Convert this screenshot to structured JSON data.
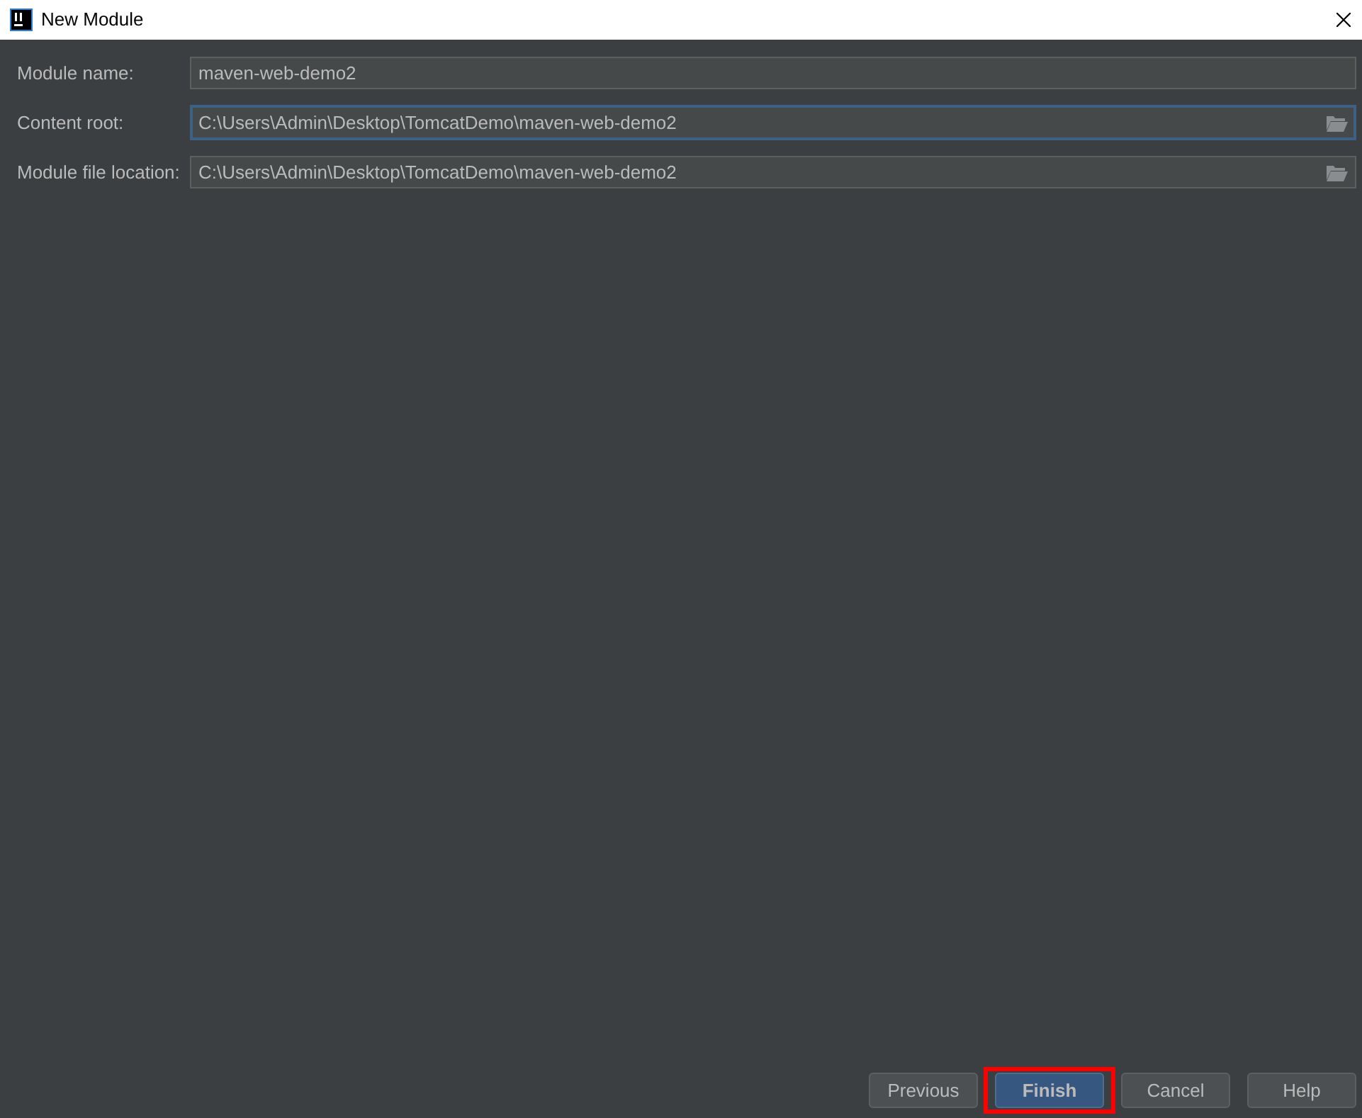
{
  "window": {
    "title": "New Module"
  },
  "fields": [
    {
      "label": "Module name:",
      "value": "maven-web-demo2",
      "focused": false,
      "browse": false
    },
    {
      "label": "Content root:",
      "value": "C:\\Users\\Admin\\Desktop\\TomcatDemo\\maven-web-demo2",
      "focused": true,
      "browse": true
    },
    {
      "label": "Module file location:",
      "value": "C:\\Users\\Admin\\Desktop\\TomcatDemo\\maven-web-demo2",
      "focused": false,
      "browse": true
    }
  ],
  "buttons": [
    {
      "label": "Previous",
      "default": false,
      "highlighted": false
    },
    {
      "label": "Finish",
      "default": true,
      "highlighted": true
    },
    {
      "label": "Cancel",
      "default": false,
      "highlighted": false
    },
    {
      "label": "Help",
      "default": false,
      "highlighted": false
    }
  ]
}
